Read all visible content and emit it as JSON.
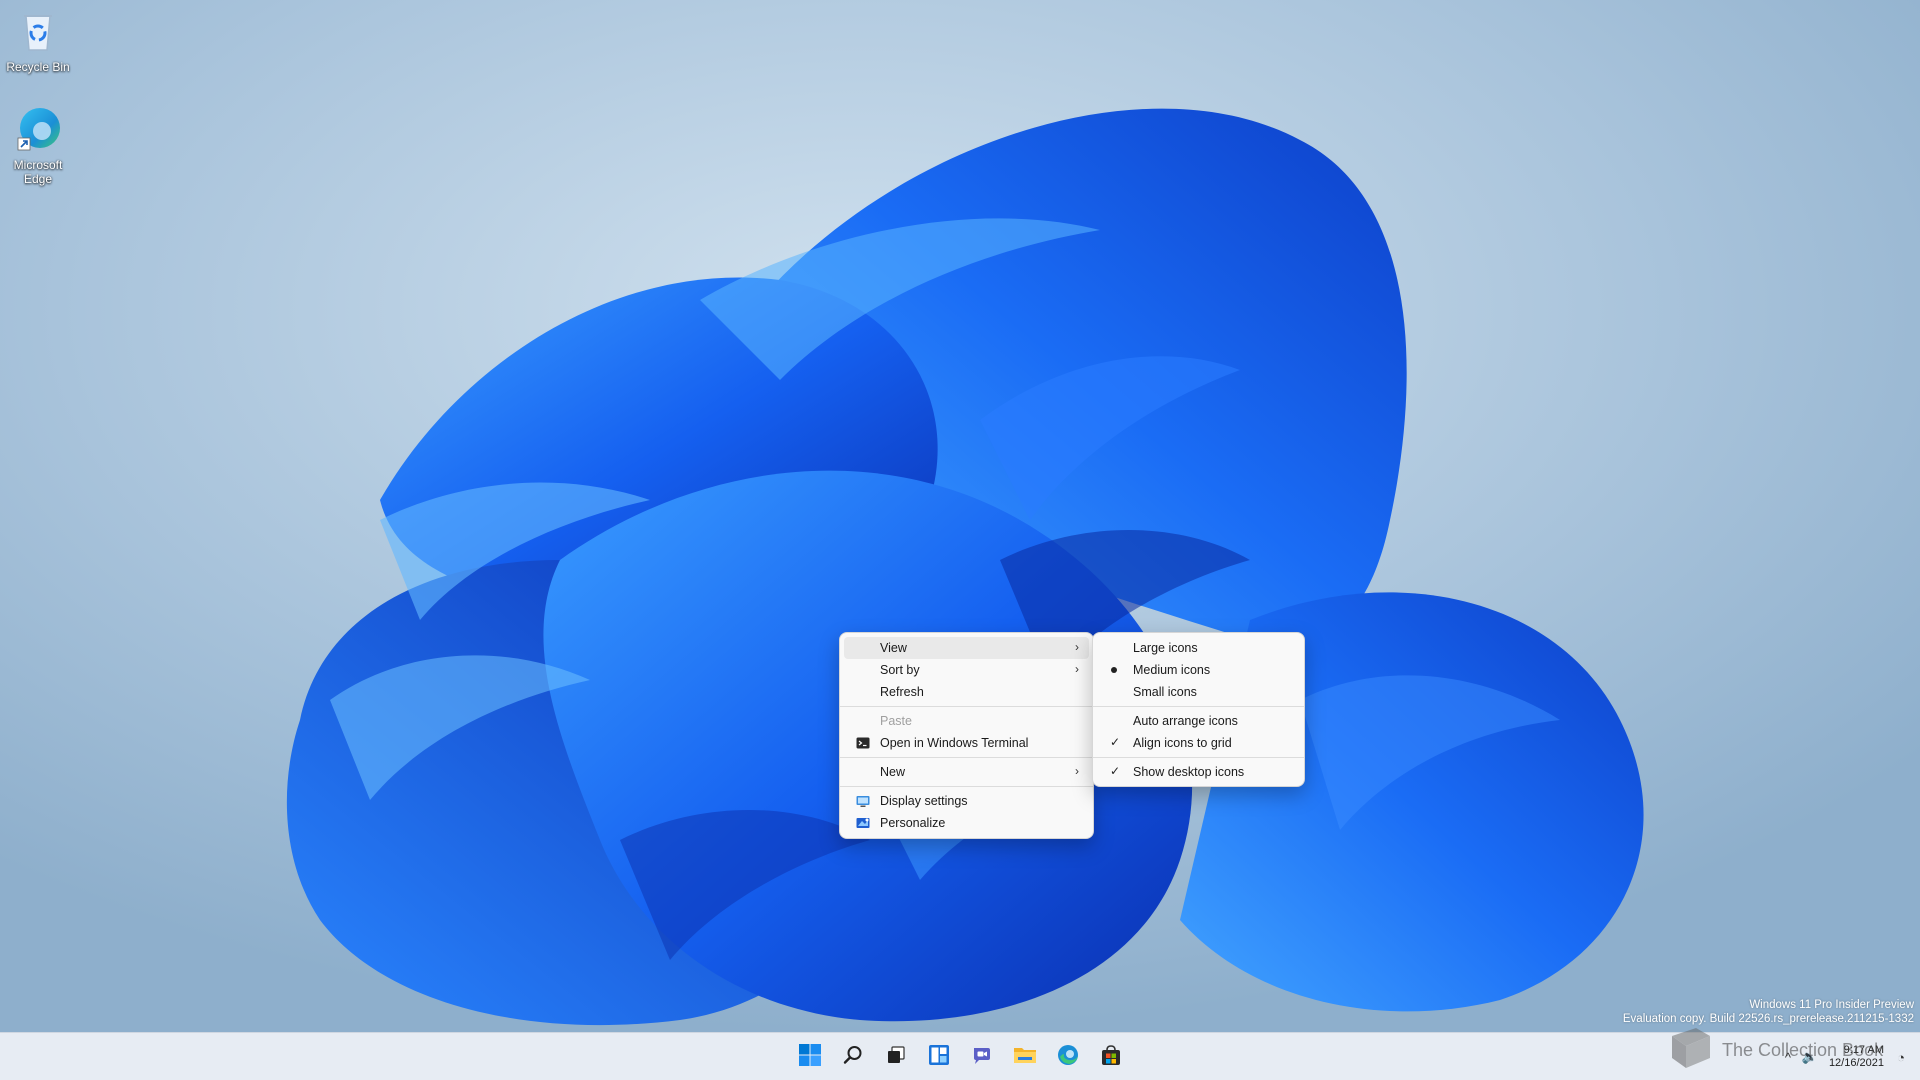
{
  "desktop": {
    "icons": [
      {
        "label": "Recycle Bin",
        "icon": "recycle-bin-icon"
      },
      {
        "label": "Microsoft Edge",
        "icon": "edge-icon"
      }
    ]
  },
  "context_menu": {
    "items": [
      {
        "label": "View",
        "submenu": true,
        "hover": true
      },
      {
        "label": "Sort by",
        "submenu": true
      },
      {
        "label": "Refresh"
      },
      {
        "label": "Paste",
        "disabled": true
      },
      {
        "label": "Open in Windows Terminal",
        "icon": "terminal-icon"
      },
      {
        "label": "New",
        "submenu": true
      },
      {
        "label": "Display settings",
        "icon": "display-icon"
      },
      {
        "label": "Personalize",
        "icon": "personalize-icon"
      }
    ]
  },
  "view_submenu": {
    "items": [
      {
        "label": "Large icons"
      },
      {
        "label": "Medium icons",
        "selected": true
      },
      {
        "label": "Small icons"
      },
      {
        "label": "Auto arrange icons"
      },
      {
        "label": "Align icons to grid",
        "checked": true
      },
      {
        "label": "Show desktop icons",
        "checked": true
      }
    ]
  },
  "watermark": {
    "line1": "Windows 11 Pro Insider Preview",
    "line2": "Evaluation copy. Build 22526.rs_prerelease.211215-1332"
  },
  "taskbar": {
    "buttons": [
      "start-icon",
      "search-icon",
      "task-view-icon",
      "widgets-icon",
      "chat-icon",
      "file-explorer-icon",
      "edge-icon",
      "store-icon"
    ],
    "tray": {
      "time": "9:17 AM",
      "date": "12/16/2021"
    }
  },
  "overlay": {
    "channel_name": "The Collection Book"
  },
  "colors": {
    "accent": "#0067c0",
    "bloom": "#1560f0",
    "menu_bg": "#f9f9f9",
    "taskbar_bg": "#e7ecf3"
  }
}
